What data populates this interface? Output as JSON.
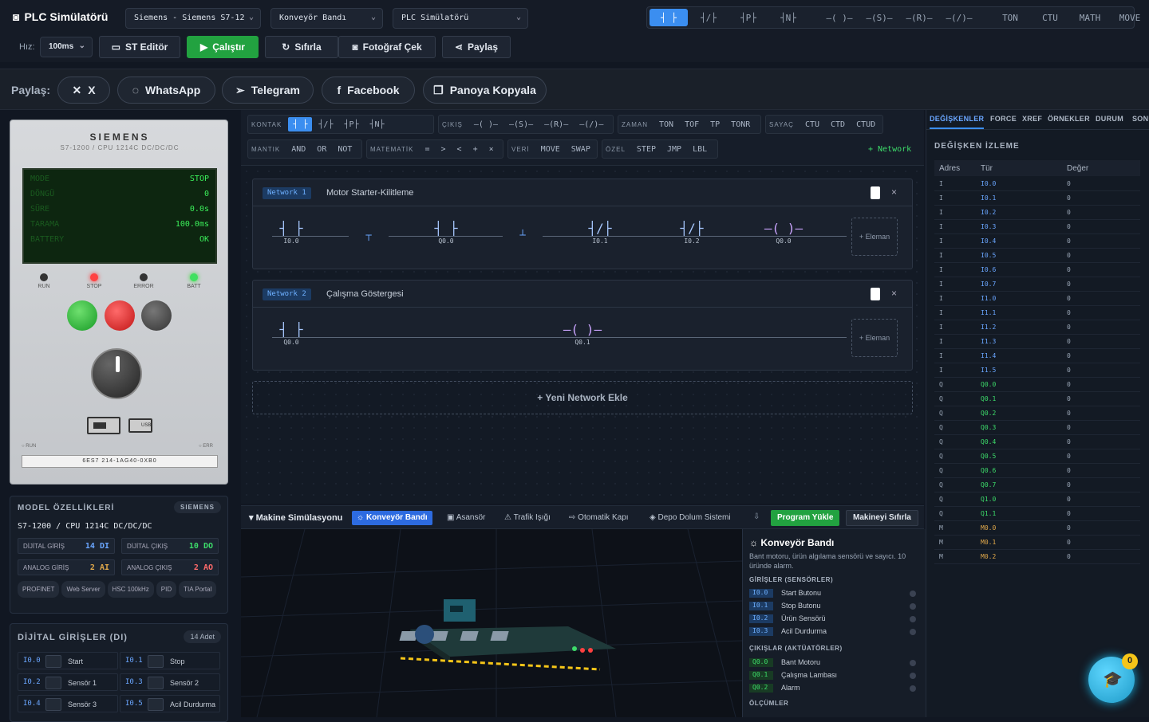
{
  "app": {
    "title": "PLC Simülatörü",
    "selects": [
      "Siemens - Siemens S7-12",
      "Konveyör Bandı",
      "PLC Simülatörü"
    ],
    "speed_label": "Hız:",
    "speed_value": "100ms",
    "buttons": {
      "st_editor": "ST Editör",
      "run": "Çalıştır",
      "reset": "Sıfırla",
      "photo": "Fotoğraf Çek",
      "share": "Paylaş"
    },
    "palette": [
      "┤ ├",
      "┤/├",
      "┤P├",
      "┤N├",
      "–( )–",
      "–(S)–",
      "–(R)–",
      "–(/)–",
      "TON",
      "CTU",
      "MATH",
      "MOVE"
    ]
  },
  "share": {
    "label": "Paylaş:",
    "items": [
      "X",
      "WhatsApp",
      "Telegram",
      "Facebook",
      "Panoya Kopyala"
    ]
  },
  "plc": {
    "brand": "SIEMENS",
    "model": "S7-1200 / CPU 1214C DC/DC/DC",
    "lcd": [
      {
        "k": "MODE",
        "v": "STOP"
      },
      {
        "k": "DÖNGÜ",
        "v": "0"
      },
      {
        "k": "SÜRE",
        "v": "0.0s"
      },
      {
        "k": "TARAMA",
        "v": "100.0ms"
      },
      {
        "k": "BATTERY",
        "v": "OK"
      }
    ],
    "leds": [
      "RUN",
      "STOP",
      "ERROR",
      "BATT"
    ],
    "run_label": "RUN",
    "err_label": "ERR",
    "usb_label": "USB",
    "serial": "6ES7 214-1AG40-0XB0"
  },
  "model_card": {
    "title": "MODEL ÖZELLİKLERİ",
    "badge": "SIEMENS",
    "name": "S7-1200 / CPU 1214C DC/DC/DC",
    "specs": [
      {
        "k": "DİJİTAL GİRİŞ",
        "v": "14 DI"
      },
      {
        "k": "DİJİTAL ÇIKIŞ",
        "v": "10 DO"
      },
      {
        "k": "ANALOG GİRİŞ",
        "v": "2 AI"
      },
      {
        "k": "ANALOG ÇIKIŞ",
        "v": "2 AO"
      }
    ],
    "tags": [
      "PROFINET",
      "Web Server",
      "HSC 100kHz",
      "PID",
      "TIA Portal"
    ]
  },
  "di_card": {
    "title": "DİJİTAL GİRİŞLER (DI)",
    "count": "14 Adet",
    "items": [
      {
        "a": "I0.0",
        "n": "Start"
      },
      {
        "a": "I0.1",
        "n": "Stop"
      },
      {
        "a": "I0.2",
        "n": "Sensör 1"
      },
      {
        "a": "I0.3",
        "n": "Sensör 2"
      },
      {
        "a": "I0.4",
        "n": "Sensör 3"
      },
      {
        "a": "I0.5",
        "n": "Acil Durdurma"
      }
    ]
  },
  "toolbox": {
    "kontak": {
      "label": "KONTAK",
      "items": [
        "┤ ├",
        "┤/├",
        "┤P├",
        "┤N├"
      ]
    },
    "cikis": {
      "label": "ÇIKIŞ",
      "items": [
        "–( )–",
        "–(S)–",
        "–(R)–",
        "–(/)–"
      ]
    },
    "zaman": {
      "label": "ZAMAN",
      "items": [
        "TON",
        "TOF",
        "TP",
        "TONR"
      ]
    },
    "sayac": {
      "label": "SAYAÇ",
      "items": [
        "CTU",
        "CTD",
        "CTUD"
      ]
    },
    "mantik": {
      "label": "MANTIK",
      "items": [
        "AND",
        "OR",
        "NOT"
      ]
    },
    "matematik": {
      "label": "MATEMATİK",
      "items": [
        "=",
        ">",
        "<",
        "+",
        "×"
      ]
    },
    "veri": {
      "label": "VERİ",
      "items": [
        "MOVE",
        "SWAP"
      ]
    },
    "ozel": {
      "label": "ÖZEL",
      "items": [
        "STEP",
        "JMP",
        "LBL"
      ]
    },
    "add_network": "+ Network"
  },
  "networks": [
    {
      "badge": "Network 1",
      "title": "Motor Starter-Kilitleme",
      "elements": [
        {
          "sym": "┤ ├",
          "addr": "I0.0"
        },
        {
          "sym": "┬",
          "addr": ""
        },
        {
          "sym": "┤ ├",
          "addr": "Q0.0"
        },
        {
          "sym": "┴",
          "addr": ""
        },
        {
          "sym": "┤/├",
          "addr": "I0.1"
        },
        {
          "sym": "┤/├",
          "addr": "I0.2"
        },
        {
          "sym": "–( )–",
          "addr": "Q0.0"
        }
      ]
    },
    {
      "badge": "Network 2",
      "title": "Çalışma Göstergesi",
      "elements": [
        {
          "sym": "┤ ├",
          "addr": "Q0.0"
        },
        {
          "sym": "–( )–",
          "addr": "Q0.1"
        }
      ]
    }
  ],
  "add_element": "+ Eleman",
  "new_network": "+ Yeni Network Ekle",
  "sim": {
    "title": "Makine Simülasyonu",
    "tabs": [
      "Konveyör Bandı",
      "Asansör",
      "Trafik Işığı",
      "Otomatik Kapı",
      "Depo Dolum Sistemi"
    ],
    "load": "Program Yükle",
    "reset": "Makineyi Sıfırla",
    "info_title": "Konveyör Bandı",
    "info_desc": "Bant motoru, ürün algılama sensörü ve sayıcı. 10 üründe alarm.",
    "inputs_label": "GİRİŞLER (SENSÖRLER)",
    "inputs": [
      {
        "a": "I0.0",
        "n": "Start Butonu"
      },
      {
        "a": "I0.1",
        "n": "Stop Butonu"
      },
      {
        "a": "I0.2",
        "n": "Ürün Sensörü"
      },
      {
        "a": "I0.3",
        "n": "Acil Durdurma"
      }
    ],
    "outputs_label": "ÇIKIŞLAR (AKTÜATÖRLER)",
    "outputs": [
      {
        "a": "Q0.0",
        "n": "Bant Motoru"
      },
      {
        "a": "Q0.1",
        "n": "Çalışma Lambası"
      },
      {
        "a": "Q0.2",
        "n": "Alarm"
      }
    ],
    "measure_label": "ÖLÇÜMLER"
  },
  "right": {
    "tabs": [
      "DEĞİŞKENLER",
      "FORCE",
      "XREF",
      "ÖRNEKLER",
      "DURUM",
      "SONU"
    ],
    "title": "DEĞİŞKEN İZLEME",
    "headers": [
      "Adres",
      "Tür",
      "Değer"
    ],
    "rows": [
      [
        "I",
        "I0.0",
        "0"
      ],
      [
        "I",
        "I0.1",
        "0"
      ],
      [
        "I",
        "I0.2",
        "0"
      ],
      [
        "I",
        "I0.3",
        "0"
      ],
      [
        "I",
        "I0.4",
        "0"
      ],
      [
        "I",
        "I0.5",
        "0"
      ],
      [
        "I",
        "I0.6",
        "0"
      ],
      [
        "I",
        "I0.7",
        "0"
      ],
      [
        "I",
        "I1.0",
        "0"
      ],
      [
        "I",
        "I1.1",
        "0"
      ],
      [
        "I",
        "I1.2",
        "0"
      ],
      [
        "I",
        "I1.3",
        "0"
      ],
      [
        "I",
        "I1.4",
        "0"
      ],
      [
        "I",
        "I1.5",
        "0"
      ],
      [
        "Q",
        "Q0.0",
        "0"
      ],
      [
        "Q",
        "Q0.1",
        "0"
      ],
      [
        "Q",
        "Q0.2",
        "0"
      ],
      [
        "Q",
        "Q0.3",
        "0"
      ],
      [
        "Q",
        "Q0.4",
        "0"
      ],
      [
        "Q",
        "Q0.5",
        "0"
      ],
      [
        "Q",
        "Q0.6",
        "0"
      ],
      [
        "Q",
        "Q0.7",
        "0"
      ],
      [
        "Q",
        "Q1.0",
        "0"
      ],
      [
        "Q",
        "Q1.1",
        "0"
      ],
      [
        "M",
        "M0.0",
        "0"
      ],
      [
        "M",
        "M0.1",
        "0"
      ],
      [
        "M",
        "M0.2",
        "0"
      ]
    ]
  },
  "help_badge": "0",
  "colors": {
    "accent": "#3b8ef0",
    "run": "#22a240",
    "input_addr": "#6aa6ff",
    "output_addr": "#3ddc6a",
    "memory_addr": "#e0a84a"
  }
}
